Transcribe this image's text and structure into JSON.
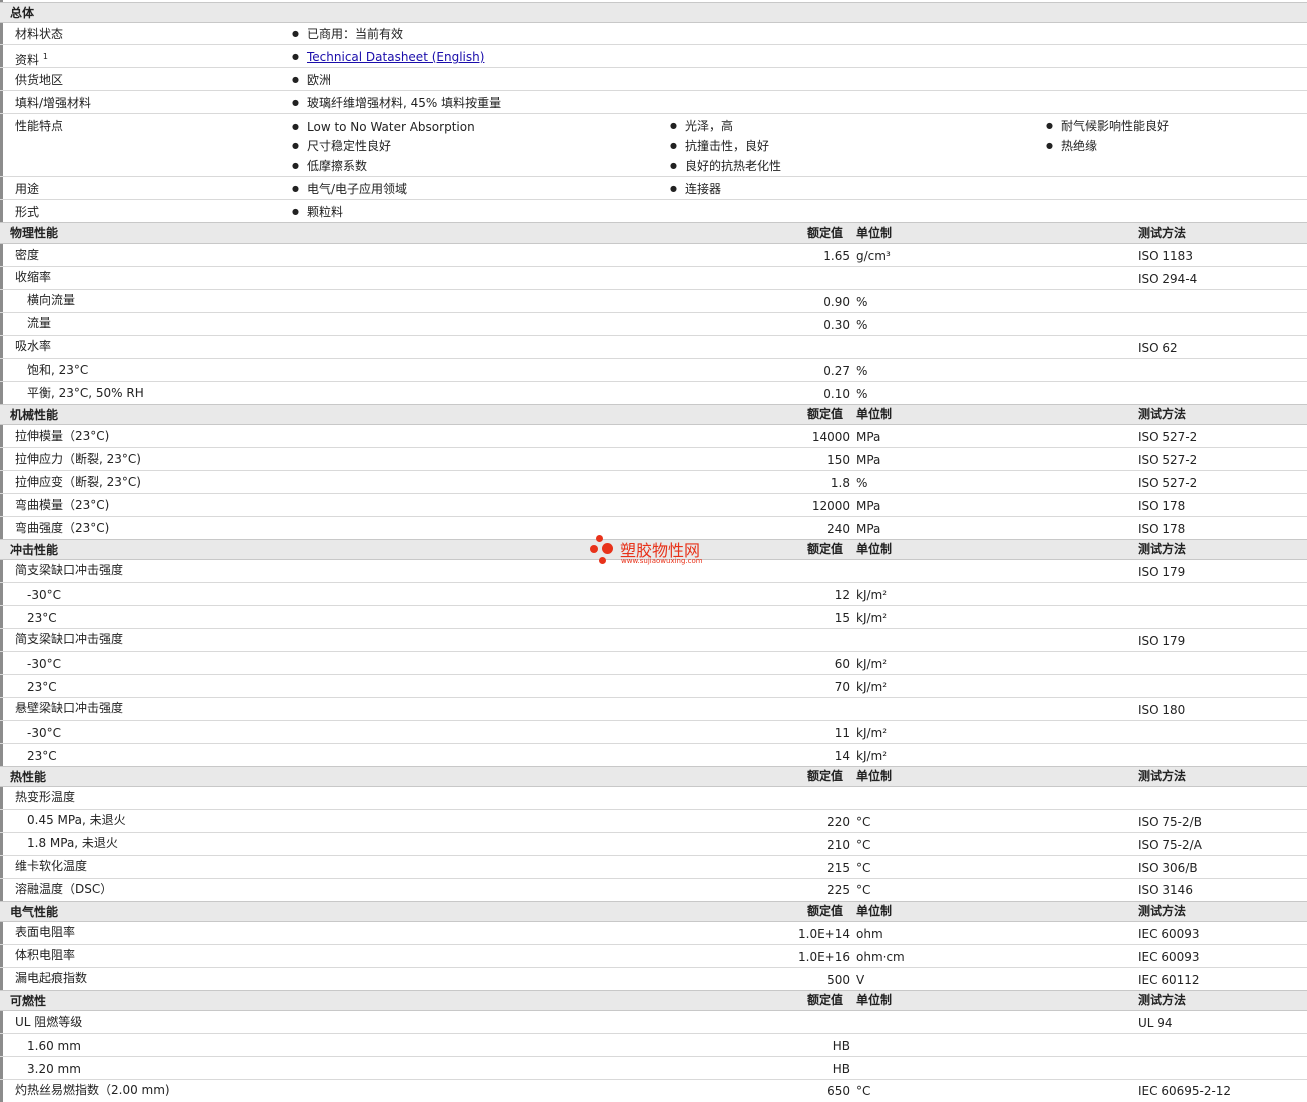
{
  "general": {
    "title": "总体",
    "status_label": "材料状态",
    "status_value": "已商用：当前有效",
    "docs_label": "资料",
    "docs_sup": "1",
    "docs_link": "Technical Datasheet (English)",
    "region_label": "供货地区",
    "region_value": "欧洲",
    "filler_label": "填料/增强材料",
    "filler_value": "玻璃纤维增强材料, 45% 填料按重量",
    "features_label": "性能特点",
    "features": [
      "Low to No Water Absorption",
      "光泽，高",
      "耐气候影响性能良好",
      "尺寸稳定性良好",
      "抗撞击性，良好",
      "热绝缘",
      "低摩擦系数",
      "良好的抗热老化性"
    ],
    "uses_label": "用途",
    "uses": [
      "电气/电子应用领域",
      "连接器"
    ],
    "form_label": "形式",
    "form_value": "颗粒料"
  },
  "headers": {
    "nominal": "额定值",
    "unit": "单位制",
    "test": "测试方法"
  },
  "physical": {
    "title": "物理性能",
    "density": {
      "label": "密度",
      "value": "1.65",
      "unit": "g/cm³",
      "test": "ISO 1183"
    },
    "shrink": {
      "label": "收缩率",
      "test": "ISO 294-4"
    },
    "shrink_tf": {
      "label": "横向流量",
      "value": "0.90",
      "unit": "%"
    },
    "shrink_f": {
      "label": "流量",
      "value": "0.30",
      "unit": "%"
    },
    "water": {
      "label": "吸水率",
      "test": "ISO 62"
    },
    "water_sat": {
      "label": "饱和, 23°C",
      "value": "0.27",
      "unit": "%"
    },
    "water_eq": {
      "label": "平衡, 23°C, 50% RH",
      "value": "0.10",
      "unit": "%"
    }
  },
  "mechanical": {
    "title": "机械性能",
    "tm": {
      "label": "拉伸模量（23°C)",
      "value": "14000",
      "unit": "MPa",
      "test": "ISO 527-2"
    },
    "ts": {
      "label": "拉伸应力（断裂, 23°C)",
      "value": "150",
      "unit": "MPa",
      "test": "ISO 527-2"
    },
    "te": {
      "label": "拉伸应变（断裂, 23°C)",
      "value": "1.8",
      "unit": "%",
      "test": "ISO 527-2"
    },
    "fm": {
      "label": "弯曲模量（23°C)",
      "value": "12000",
      "unit": "MPa",
      "test": "ISO 178"
    },
    "fs": {
      "label": "弯曲强度（23°C)",
      "value": "240",
      "unit": "MPa",
      "test": "ISO 178"
    }
  },
  "impact": {
    "title": "冲击性能",
    "c1": {
      "label": "简支梁缺口冲击强度",
      "test": "ISO 179"
    },
    "c1a": {
      "label": "-30°C",
      "value": "12",
      "unit": "kJ/m²"
    },
    "c1b": {
      "label": "23°C",
      "value": "15",
      "unit": "kJ/m²"
    },
    "c2": {
      "label": "简支梁缺口冲击强度",
      "test": "ISO 179"
    },
    "c2a": {
      "label": "-30°C",
      "value": "60",
      "unit": "kJ/m²"
    },
    "c2b": {
      "label": "23°C",
      "value": "70",
      "unit": "kJ/m²"
    },
    "iz": {
      "label": "悬壁梁缺口冲击强度",
      "test": "ISO 180"
    },
    "iza": {
      "label": "-30°C",
      "value": "11",
      "unit": "kJ/m²"
    },
    "izb": {
      "label": "23°C",
      "value": "14",
      "unit": "kJ/m²"
    }
  },
  "thermal": {
    "title": "热性能",
    "hdt": {
      "label": "热变形温度"
    },
    "hdt1": {
      "label": "0.45 MPa, 未退火",
      "value": "220",
      "unit": "°C",
      "test": "ISO 75-2/B"
    },
    "hdt2": {
      "label": "1.8 MPa, 未退火",
      "value": "210",
      "unit": "°C",
      "test": "ISO 75-2/A"
    },
    "vicat": {
      "label": "维卡软化温度",
      "value": "215",
      "unit": "°C",
      "test": "ISO 306/B"
    },
    "melt": {
      "label": "溶融温度（DSC）",
      "value": "225",
      "unit": "°C",
      "test": "ISO 3146"
    }
  },
  "electrical": {
    "title": "电气性能",
    "sr": {
      "label": "表面电阻率",
      "value": "1.0E+14",
      "unit": "ohm",
      "test": "IEC 60093"
    },
    "vr": {
      "label": "体积电阻率",
      "value": "1.0E+16",
      "unit": "ohm·cm",
      "test": "IEC 60093"
    },
    "cti": {
      "label": "漏电起痕指数",
      "value": "500",
      "unit": "V",
      "test": "IEC 60112"
    }
  },
  "flammability": {
    "title": "可燃性",
    "ul": {
      "label": "UL 阻燃等级",
      "test": "UL 94"
    },
    "ul1": {
      "label": "1.60 mm",
      "value": "HB"
    },
    "ul2": {
      "label": "3.20 mm",
      "value": "HB"
    },
    "gwfi": {
      "label": "灼热丝易燃指数（2.00 mm)",
      "value": "650",
      "unit": "°C",
      "test": "IEC 60695-2-12"
    }
  },
  "watermark": {
    "text": "塑胶物性网",
    "url": "www.sujiaowuxing.com"
  }
}
